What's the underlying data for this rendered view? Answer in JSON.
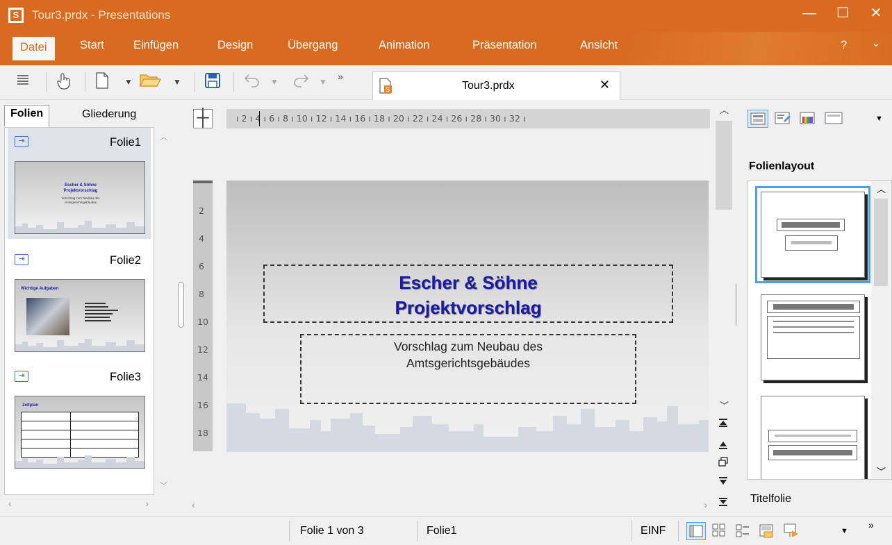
{
  "window": {
    "logo_letter": "S",
    "title": "Tour3.prdx - Presentations",
    "controls": [
      "—",
      "☐",
      "✕"
    ]
  },
  "menu": {
    "items": [
      "Datei",
      "Start",
      "Einfügen",
      "Design",
      "Übergang",
      "Animation",
      "Präsentation",
      "Ansicht"
    ],
    "help": "?",
    "collapse": "⌄"
  },
  "toolbar": {
    "more": "»",
    "icons": [
      "hamburger-menu-icon",
      "hand-icon",
      "new-document-icon",
      "open-folder-icon",
      "save-icon",
      "undo-icon",
      "redo-icon"
    ]
  },
  "document_tab": {
    "title": "Tour3.prdx",
    "close": "✕"
  },
  "left_panel": {
    "tabs": [
      "Folien",
      "Gliederung"
    ],
    "slides": [
      {
        "name": "Folie1",
        "thumb_title_1": "Escher & Söhne",
        "thumb_title_2": "Projektvorschlag",
        "thumb_sub": "Vorschlag zum Neubau des Amtsgerichtsgebäudes"
      },
      {
        "name": "Folie2",
        "thumb_title_1": "Wichtige Aufgaben"
      },
      {
        "name": "Folie3",
        "thumb_title_1": "Zeitplan"
      }
    ]
  },
  "ruler": {
    "horizontal": "ı 2 ı 4 ı 6 ı 8 ı 10 ı 12 ı 14 ı 16 ı 18 ı 20 ı 22 ı 24 ı 26 ı 28 ı 30 ı 32 ı",
    "vertical": [
      "2",
      "4",
      "6",
      "8",
      "10",
      "12",
      "14",
      "16",
      "18"
    ]
  },
  "slide": {
    "title_line_1": "Escher & Söhne",
    "title_line_2": "Projektvorschlag",
    "subtitle_line_1": "Vorschlag zum Neubau des",
    "subtitle_line_2": "Amtsgerichtsgebäudes"
  },
  "right_panel": {
    "heading": "Folienlayout",
    "selected_layout": "Titelfolie"
  },
  "status": {
    "slide_position": "Folie 1 von 3",
    "slide_name": "Folie1",
    "mode": "EINF",
    "more": "»"
  },
  "colors": {
    "accent": "#d86b20",
    "title_text": "#1a1aa6",
    "selection": "#4aa0f0"
  }
}
